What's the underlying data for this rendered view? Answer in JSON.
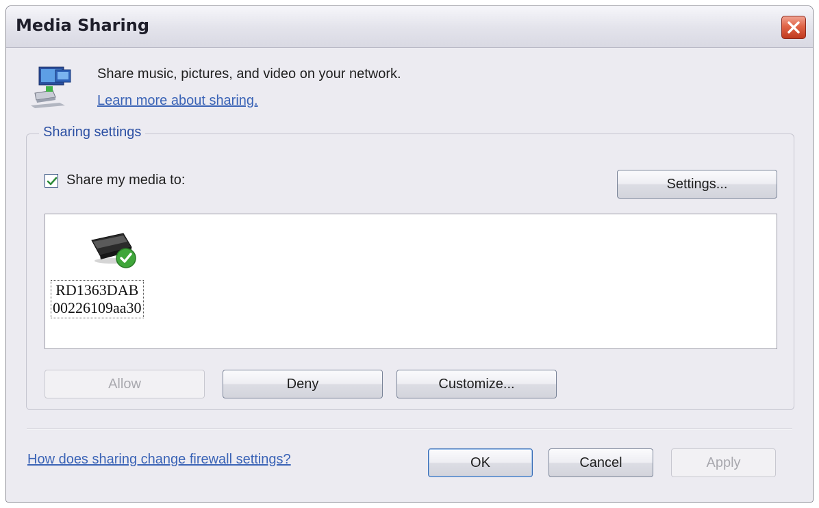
{
  "window": {
    "title": "Media Sharing",
    "close_icon": "close-icon"
  },
  "header": {
    "icon": "network-computers-icon",
    "description": "Share music, pictures, and video on your network.",
    "learn_more_link": "Learn more about sharing."
  },
  "sharing_settings": {
    "legend": "Sharing settings",
    "share_checkbox": {
      "checked": true,
      "label": "Share my media to:"
    },
    "settings_button": "Settings...",
    "devices": [
      {
        "name": "RD1363DAB",
        "id": "00226109aa30",
        "status": "allowed",
        "icon": "media-device-allowed-icon"
      }
    ],
    "allow_button": {
      "label": "Allow",
      "enabled": false
    },
    "deny_button": {
      "label": "Deny",
      "enabled": true
    },
    "customize_button": {
      "label": "Customize...",
      "enabled": true
    }
  },
  "footer": {
    "firewall_link": "How does sharing change firewall settings?",
    "ok_button": {
      "label": "OK",
      "enabled": true
    },
    "cancel_button": {
      "label": "Cancel",
      "enabled": true
    },
    "apply_button": {
      "label": "Apply",
      "enabled": false
    }
  },
  "colors": {
    "link": "#3a63b6",
    "legend": "#2b4fa3",
    "dialog_bg": "#ecebf1",
    "close_button": "#d9553a",
    "check_badge": "#3fa63a"
  }
}
